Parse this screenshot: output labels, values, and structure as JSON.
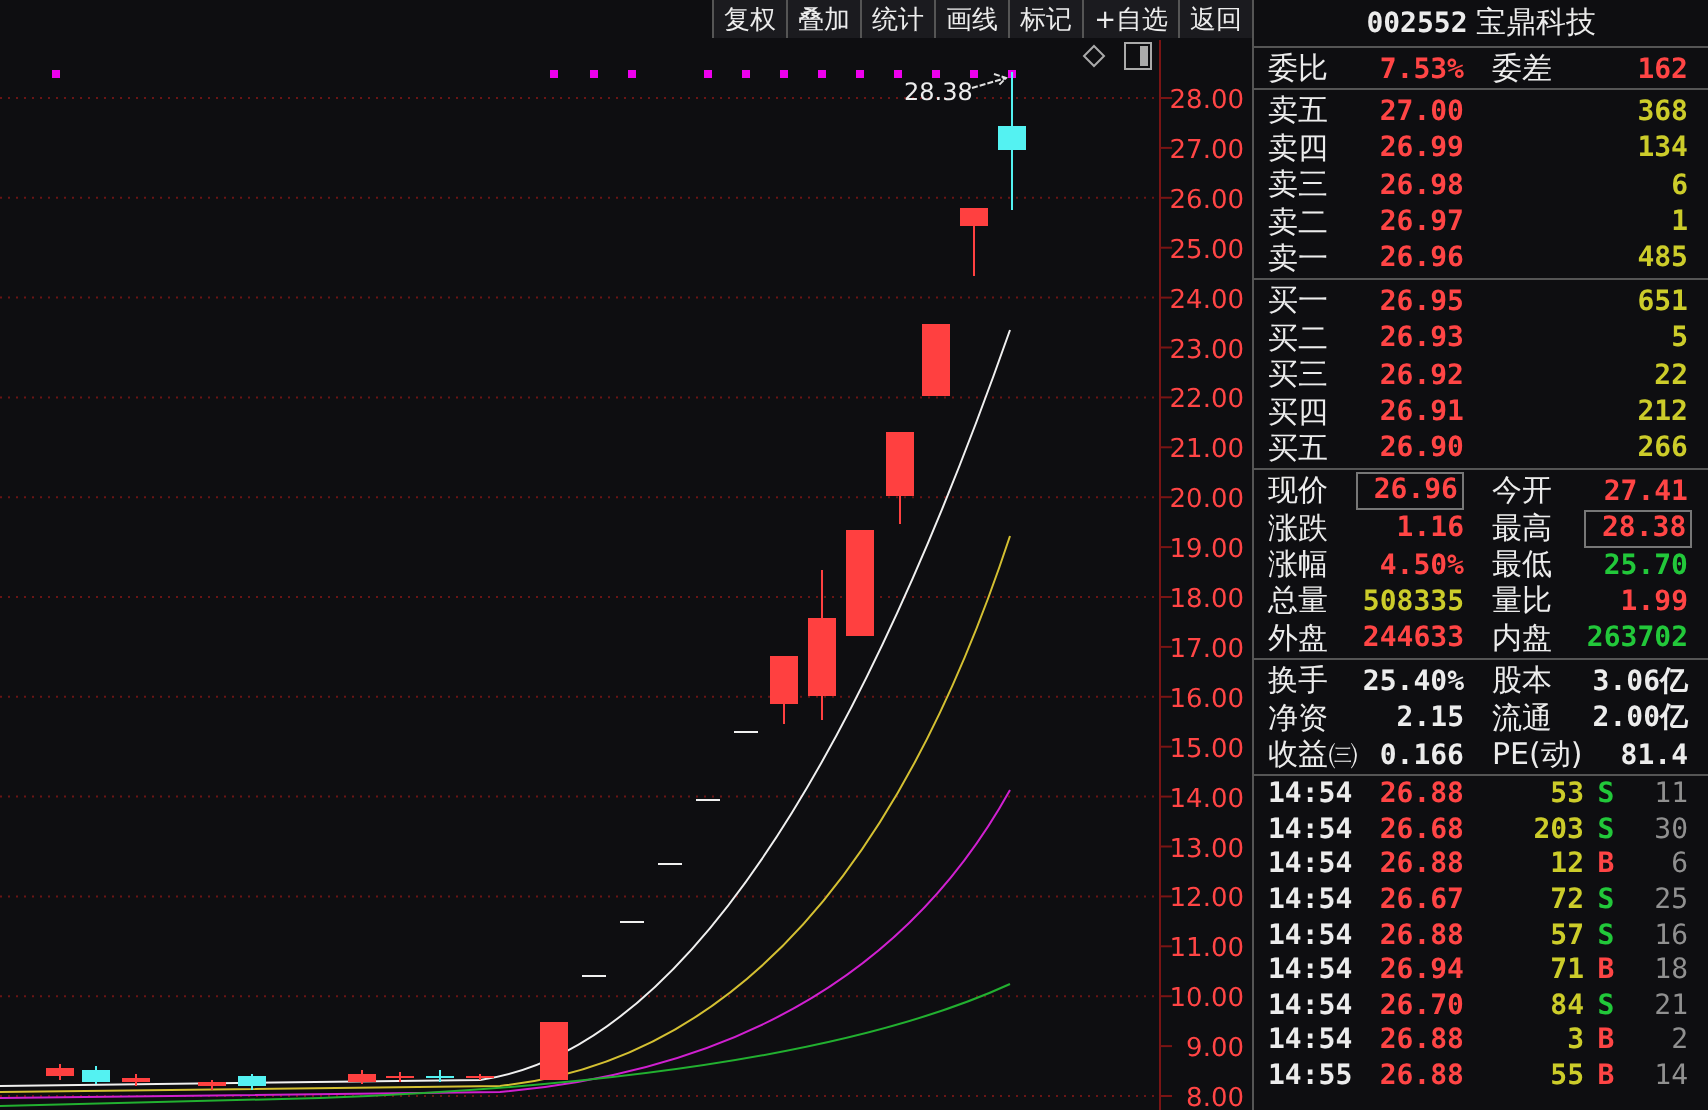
{
  "toolbar": [
    {
      "label": "复权"
    },
    {
      "label": "叠加"
    },
    {
      "label": "统计"
    },
    {
      "label": "画线"
    },
    {
      "label": "标记"
    },
    {
      "label": "+自选"
    },
    {
      "label": "返回"
    }
  ],
  "chart": {
    "high_label": "28.38",
    "price_axis": [
      "28.00",
      "27.00",
      "26.00",
      "25.00",
      "24.00",
      "23.00",
      "22.00",
      "21.00",
      "20.00",
      "19.00",
      "18.00",
      "17.00",
      "16.00",
      "15.00",
      "14.00",
      "13.00",
      "12.00",
      "11.00",
      "10.00",
      "9.00",
      "8.00"
    ]
  },
  "quote": {
    "code": "002552",
    "name": "宝鼎科技"
  },
  "bid_ratio": {
    "label": "委比",
    "value": "7.53%",
    "diff_label": "委差",
    "diff_value": "162"
  },
  "asks": [
    {
      "label": "卖五",
      "price": "27.00",
      "volume": "368"
    },
    {
      "label": "卖四",
      "price": "26.99",
      "volume": "134"
    },
    {
      "label": "卖三",
      "price": "26.98",
      "volume": "6"
    },
    {
      "label": "卖二",
      "price": "26.97",
      "volume": "1"
    },
    {
      "label": "卖一",
      "price": "26.96",
      "volume": "485"
    }
  ],
  "bids": [
    {
      "label": "买一",
      "price": "26.95",
      "volume": "651"
    },
    {
      "label": "买二",
      "price": "26.93",
      "volume": "5"
    },
    {
      "label": "买三",
      "price": "26.92",
      "volume": "22"
    },
    {
      "label": "买四",
      "price": "26.91",
      "volume": "212"
    },
    {
      "label": "买五",
      "price": "26.90",
      "volume": "266"
    }
  ],
  "stats": [
    {
      "label": "现价",
      "value": "26.96",
      "color": "#ff4545",
      "boxed": true
    },
    {
      "label": "今开",
      "value": "27.41",
      "color": "#ff4545",
      "boxed": false
    },
    {
      "label": "涨跌",
      "value": "1.16",
      "color": "#ff4545",
      "boxed": false
    },
    {
      "label": "最高",
      "value": "28.38",
      "color": "#ff4545",
      "boxed": true
    },
    {
      "label": "涨幅",
      "value": "4.50%",
      "color": "#ff4545",
      "boxed": false
    },
    {
      "label": "最低",
      "value": "25.70",
      "color": "#22c83a",
      "boxed": false
    },
    {
      "label": "总量",
      "value": "508335",
      "color": "#cccc2a",
      "boxed": false
    },
    {
      "label": "量比",
      "value": "1.99",
      "color": "#ff4545",
      "boxed": false
    },
    {
      "label": "外盘",
      "value": "244633",
      "color": "#ff4545",
      "boxed": false
    },
    {
      "label": "内盘",
      "value": "263702",
      "color": "#22c83a",
      "boxed": false
    }
  ],
  "fundamentals": [
    {
      "label": "换手",
      "value": "25.40%"
    },
    {
      "label": "股本",
      "value": "3.06亿"
    },
    {
      "label": "净资",
      "value": "2.15"
    },
    {
      "label": "流通",
      "value": "2.00亿"
    },
    {
      "label": "收益㈢",
      "value": "0.166"
    },
    {
      "label": "PE(动)",
      "value": "81.4"
    }
  ],
  "trades": [
    {
      "time": "14:54",
      "price": "26.88",
      "volume": "53",
      "side": "S",
      "kind": "sell",
      "count": "11"
    },
    {
      "time": "14:54",
      "price": "26.68",
      "volume": "203",
      "side": "S",
      "kind": "sell",
      "count": "30"
    },
    {
      "time": "14:54",
      "price": "26.88",
      "volume": "12",
      "side": "B",
      "kind": "buy",
      "count": "6"
    },
    {
      "time": "14:54",
      "price": "26.67",
      "volume": "72",
      "side": "S",
      "kind": "sell",
      "count": "25"
    },
    {
      "time": "14:54",
      "price": "26.88",
      "volume": "57",
      "side": "S",
      "kind": "sell",
      "count": "16"
    },
    {
      "time": "14:54",
      "price": "26.94",
      "volume": "71",
      "side": "B",
      "kind": "buy",
      "count": "18"
    },
    {
      "time": "14:54",
      "price": "26.70",
      "volume": "84",
      "side": "S",
      "kind": "sell",
      "count": "21"
    },
    {
      "time": "14:54",
      "price": "26.88",
      "volume": "3",
      "side": "B",
      "kind": "buy",
      "count": "2"
    },
    {
      "time": "14:55",
      "price": "26.88",
      "volume": "55",
      "side": "B",
      "kind": "buy",
      "count": "14"
    }
  ]
}
